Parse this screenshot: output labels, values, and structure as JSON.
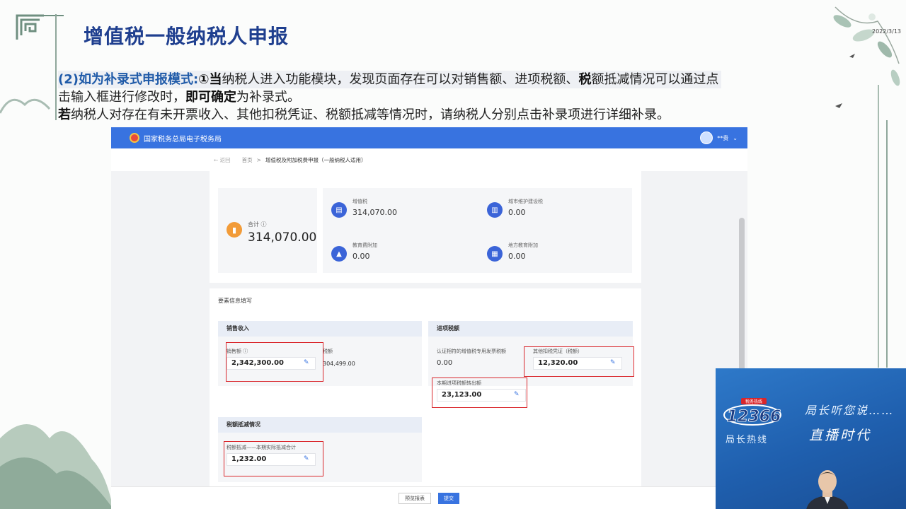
{
  "slide": {
    "title": "增值税一般纳税人申报",
    "date": "2022/3/13",
    "line1_label": "(2)如为补录式申报模式:",
    "line1_num": "①",
    "line1_bold1": "当",
    "line1_text1": "纳税人进入功能模块，发现页面存在可以对销售额、进项税额、",
    "line1_bold2": "税",
    "line1_text2": "额抵减情况可以通过点",
    "line2_text1": "击输入框进行修改时，",
    "line2_bold": "即可确定",
    "line2_text2": "为补录式。",
    "line3_bold": "若",
    "line3_text": "纳税人对存在有未开票收入、其他扣税凭证、税额抵减等情况时，请纳税人分别点击补录项进行详细补录。"
  },
  "app": {
    "brand": "国家税务总局电子税务局",
    "user": "**贵",
    "breadcrumb": {
      "back": "← 返回",
      "home": "首页",
      "sep": ">",
      "current": "增值税及附加税费申报（一般纳税人适用）"
    },
    "summary": {
      "total_label": "合计 ⓘ",
      "total_value": "314,070.00",
      "items": [
        {
          "label": "增值税",
          "value": "314,070.00"
        },
        {
          "label": "城市维护建设税",
          "value": "0.00"
        },
        {
          "label": "教育费附加",
          "value": "0.00"
        },
        {
          "label": "地方教育附加",
          "value": "0.00"
        }
      ]
    },
    "form": {
      "title": "要素信息填写",
      "sales": {
        "head": "销售收入",
        "sales_label": "销售额 ⓘ",
        "sales_value": "2,342,300.00",
        "tax_label": "税额",
        "tax_value": "304,499.00"
      },
      "input_tax": {
        "head": "进项税额",
        "cert_label": "认证相符的增值税专用发票税额",
        "cert_value": "0.00",
        "other_label": "其他扣税凭证（税额）",
        "other_value": "12,320.00",
        "transfer_label": "本期进项税额转出额",
        "transfer_value": "23,123.00"
      },
      "deduction": {
        "head": "税额抵减情况",
        "label": "税额抵减——本期实际抵减合计",
        "value": "1,232.00"
      }
    },
    "buttons": {
      "preview": "预览报表",
      "submit": "提交"
    }
  },
  "video": {
    "slogan1": "局长听您说……",
    "slogan2": "局长热线",
    "slogan3": "直播时代",
    "logo_badge": "税务热线",
    "logo_digits": "12366"
  }
}
